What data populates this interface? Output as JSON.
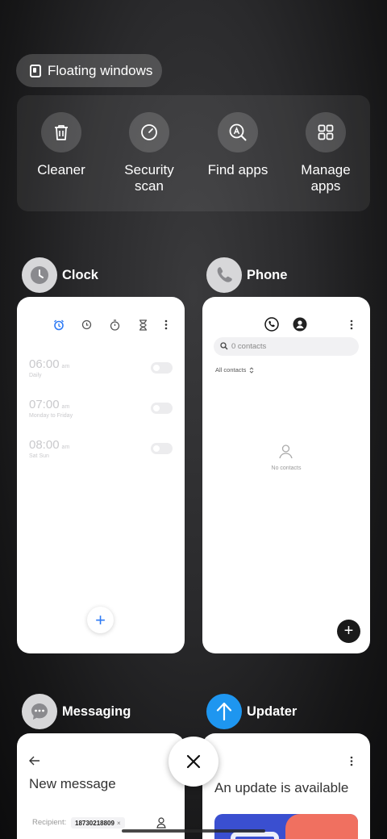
{
  "floating_windows": {
    "label": "Floating windows"
  },
  "tools": [
    {
      "label": "Cleaner",
      "icon": "trash-icon"
    },
    {
      "label": "Security scan",
      "icon": "security-scan-icon"
    },
    {
      "label": "Find apps",
      "icon": "find-apps-icon"
    },
    {
      "label": "Manage apps",
      "icon": "manage-apps-icon"
    }
  ],
  "apps": {
    "clock": {
      "name": "Clock",
      "icon": "clock-icon",
      "alarms": [
        {
          "time": "06:00",
          "ampm": "am",
          "days": "Daily",
          "enabled": false
        },
        {
          "time": "07:00",
          "ampm": "am",
          "days": "Monday to Friday",
          "enabled": false
        },
        {
          "time": "08:00",
          "ampm": "am",
          "days": "Sat Sun",
          "enabled": false
        }
      ],
      "fab": "+"
    },
    "phone": {
      "name": "Phone",
      "icon": "phone-icon",
      "search_placeholder": "0 contacts",
      "filter": "All contacts",
      "empty_text": "No contacts",
      "fab": "+"
    },
    "messaging": {
      "name": "Messaging",
      "icon": "messaging-icon",
      "title": "New message",
      "recipient_label": "Recipient:",
      "recipient_chip": "18730218809"
    },
    "updater": {
      "name": "Updater",
      "icon": "updater-icon",
      "headline": "An update is available"
    }
  },
  "colors": {
    "accent_blue": "#2f7bf5",
    "updater_blue": "#1e96f0",
    "banner_blue": "#3a4fd0",
    "banner_coral": "#f07060"
  }
}
